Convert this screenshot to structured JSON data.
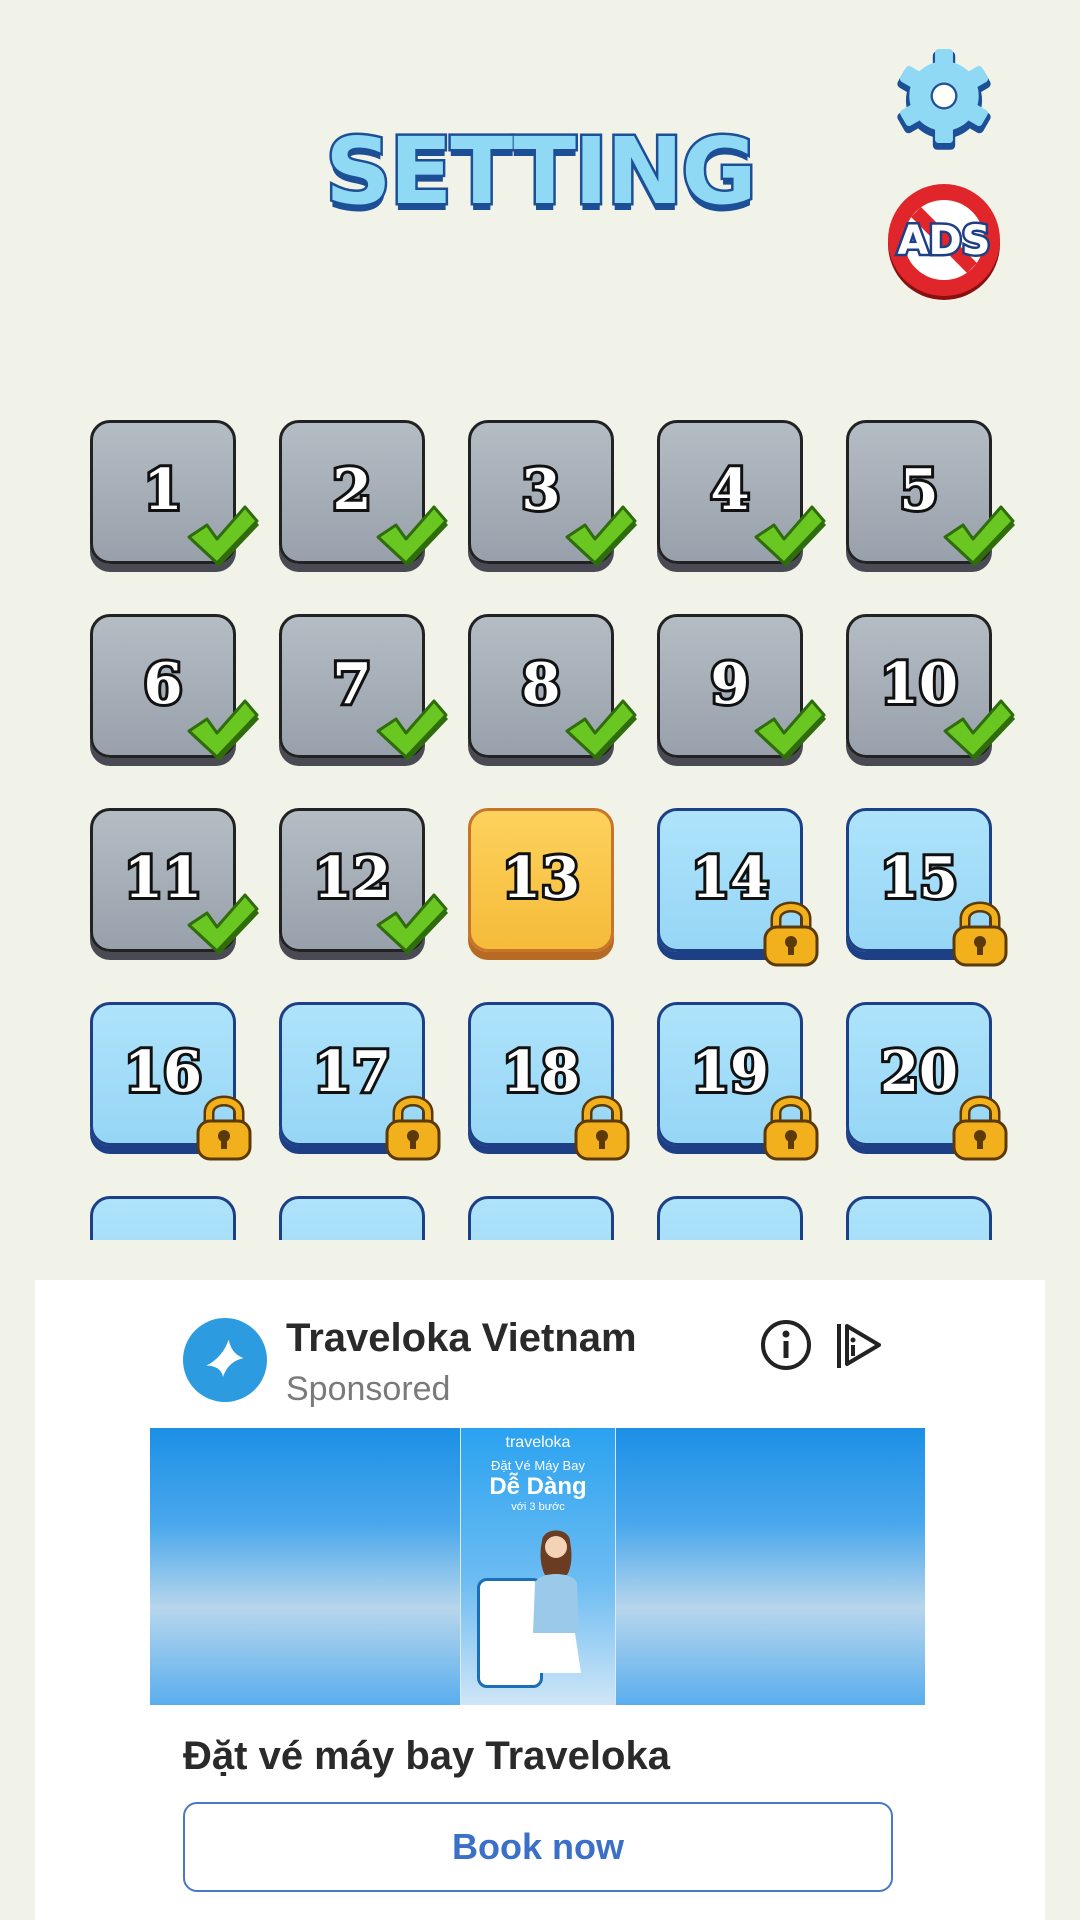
{
  "header": {
    "title": "SETTING",
    "settings_icon": "gear-icon",
    "remove_ads_label": "ADS"
  },
  "levels": [
    {
      "number": "1",
      "state": "completed"
    },
    {
      "number": "2",
      "state": "completed"
    },
    {
      "number": "3",
      "state": "completed"
    },
    {
      "number": "4",
      "state": "completed"
    },
    {
      "number": "5",
      "state": "completed"
    },
    {
      "number": "6",
      "state": "completed"
    },
    {
      "number": "7",
      "state": "completed"
    },
    {
      "number": "8",
      "state": "completed"
    },
    {
      "number": "9",
      "state": "completed"
    },
    {
      "number": "10",
      "state": "completed"
    },
    {
      "number": "11",
      "state": "completed"
    },
    {
      "number": "12",
      "state": "completed"
    },
    {
      "number": "13",
      "state": "current"
    },
    {
      "number": "14",
      "state": "locked"
    },
    {
      "number": "15",
      "state": "locked"
    },
    {
      "number": "16",
      "state": "locked"
    },
    {
      "number": "17",
      "state": "locked"
    },
    {
      "number": "18",
      "state": "locked"
    },
    {
      "number": "19",
      "state": "locked"
    },
    {
      "number": "20",
      "state": "locked"
    },
    {
      "number": "",
      "state": "locked"
    },
    {
      "number": "",
      "state": "locked"
    },
    {
      "number": "",
      "state": "locked"
    },
    {
      "number": "",
      "state": "locked"
    },
    {
      "number": "",
      "state": "locked"
    }
  ],
  "ad": {
    "advertiser": "Traveloka Vietnam",
    "sponsored": "Sponsored",
    "creative": {
      "brand": "traveloka",
      "line1": "Đặt Vé Máy Bay",
      "line2": "Dễ Dàng",
      "line3": "với 3 bước"
    },
    "headline": "Đặt vé máy bay Traveloka",
    "cta": "Book now"
  },
  "colors": {
    "background": "#f2f3e8",
    "completed_tile": "#a8b1ba",
    "current_tile": "#f9c747",
    "locked_tile": "#a5dcf7",
    "check_green": "#63c11c",
    "lock_gold": "#f2b01d",
    "cta_blue": "#3a70c8"
  }
}
